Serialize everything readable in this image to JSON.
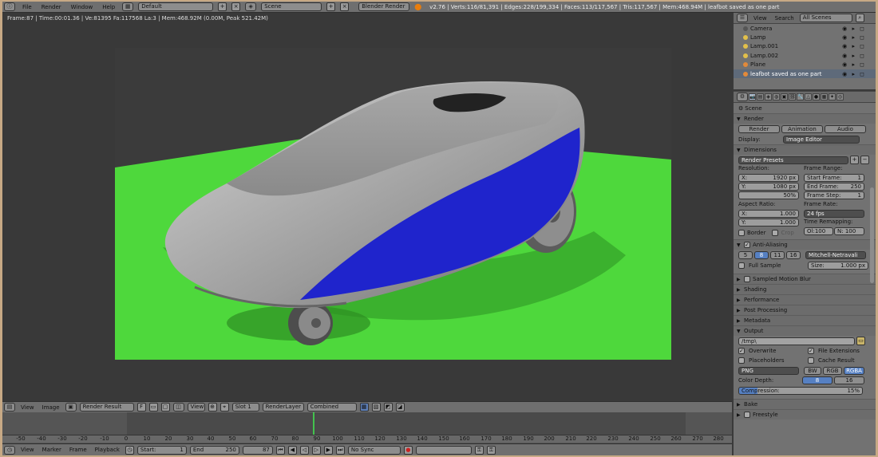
{
  "topbar": {
    "menus": [
      "File",
      "Render",
      "Window",
      "Help"
    ],
    "screen_layout": "Default",
    "scene": "Scene",
    "engine": "Blender Render",
    "stats": "v2.76 | Verts:116/81,391 | Edges:228/199,334 | Faces:113/117,567 | Tris:117,567 | Mem:468.94M | leafbot saved as one part"
  },
  "viewport": {
    "info": "Frame:87 | Time:00:01.36 | Ve:81395 Fa:117568 La:3 | Mem:468.92M (0.00M, Peak 521.42M)"
  },
  "image_editor": {
    "menus": [
      "View",
      "Image"
    ],
    "image_name": "Render Result",
    "f_label": "F",
    "view_label": "View",
    "slot": "Slot 1",
    "layer": "RenderLayer",
    "pass": "Combined"
  },
  "timeline": {
    "ticks": [
      "-50",
      "-40",
      "-30",
      "-20",
      "-10",
      "0",
      "10",
      "20",
      "30",
      "40",
      "50",
      "60",
      "70",
      "80",
      "90",
      "100",
      "110",
      "120",
      "130",
      "140",
      "150",
      "160",
      "170",
      "180",
      "190",
      "200",
      "210",
      "220",
      "230",
      "240",
      "250",
      "260",
      "270",
      "280"
    ],
    "menus": [
      "View",
      "Marker",
      "Frame",
      "Playback"
    ],
    "start": "Start:",
    "start_val": "1",
    "end": "End",
    "end_val": "250",
    "current": "87",
    "sync": "No Sync"
  },
  "outliner": {
    "menus": [
      "View",
      "Search"
    ],
    "scene_filter": "All Scenes",
    "items": [
      {
        "name": "Camera"
      },
      {
        "name": "Lamp"
      },
      {
        "name": "Lamp.001"
      },
      {
        "name": "Lamp.002"
      },
      {
        "name": "Plane"
      },
      {
        "name": "leafbot saved as one part"
      }
    ]
  },
  "properties": {
    "context": "Scene",
    "render_section": "Render",
    "render_btn": "Render",
    "animation_btn": "Animation",
    "audio_btn": "Audio",
    "display_label": "Display:",
    "display_value": "Image Editor",
    "dimensions_section": "Dimensions",
    "render_presets": "Render Presets",
    "resolution_label": "Resolution:",
    "res_x": "X:",
    "res_x_val": "1920 px",
    "res_y": "Y:",
    "res_y_val": "1080 px",
    "res_pct": "50%",
    "frame_range_label": "Frame Range:",
    "start_frame": "Start Frame:",
    "start_frame_val": "1",
    "end_frame": "End Frame:",
    "end_frame_val": "250",
    "frame_step": "Frame Step:",
    "frame_step_val": "1",
    "aspect_label": "Aspect Ratio:",
    "asp_x": "X:",
    "asp_x_val": "1.000",
    "asp_y": "Y:",
    "asp_y_val": "1.000",
    "frame_rate_label": "Frame Rate:",
    "fps": "24 fps",
    "time_remap_label": "Time Remapping:",
    "old": "Ol:100",
    "new": "N: 100",
    "border": "Border",
    "crop": "Crop",
    "aa_section": "Anti-Aliasing",
    "aa_samples": [
      "5",
      "8",
      "11",
      "16"
    ],
    "aa_filter": "Mitchell-Netravali",
    "full_sample": "Full Sample",
    "size": "Size:",
    "size_val": "1.000 px",
    "collapsed_sections": [
      "Sampled Motion Blur",
      "Shading",
      "Performance",
      "Post Processing",
      "Metadata"
    ],
    "output_section": "Output",
    "output_path": "/tmp\\",
    "overwrite": "Overwrite",
    "file_extensions": "File Extensions",
    "placeholders": "Placeholders",
    "cache_result": "Cache Result",
    "format": "PNG",
    "bw": "BW",
    "rgb": "RGB",
    "rgba": "RGBA",
    "color_depth": "Color Depth:",
    "depth_8": "8",
    "depth_16": "16",
    "compression": "Compression:",
    "compression_val": "15%",
    "bake": "Bake",
    "freestyle": "Freestyle"
  }
}
